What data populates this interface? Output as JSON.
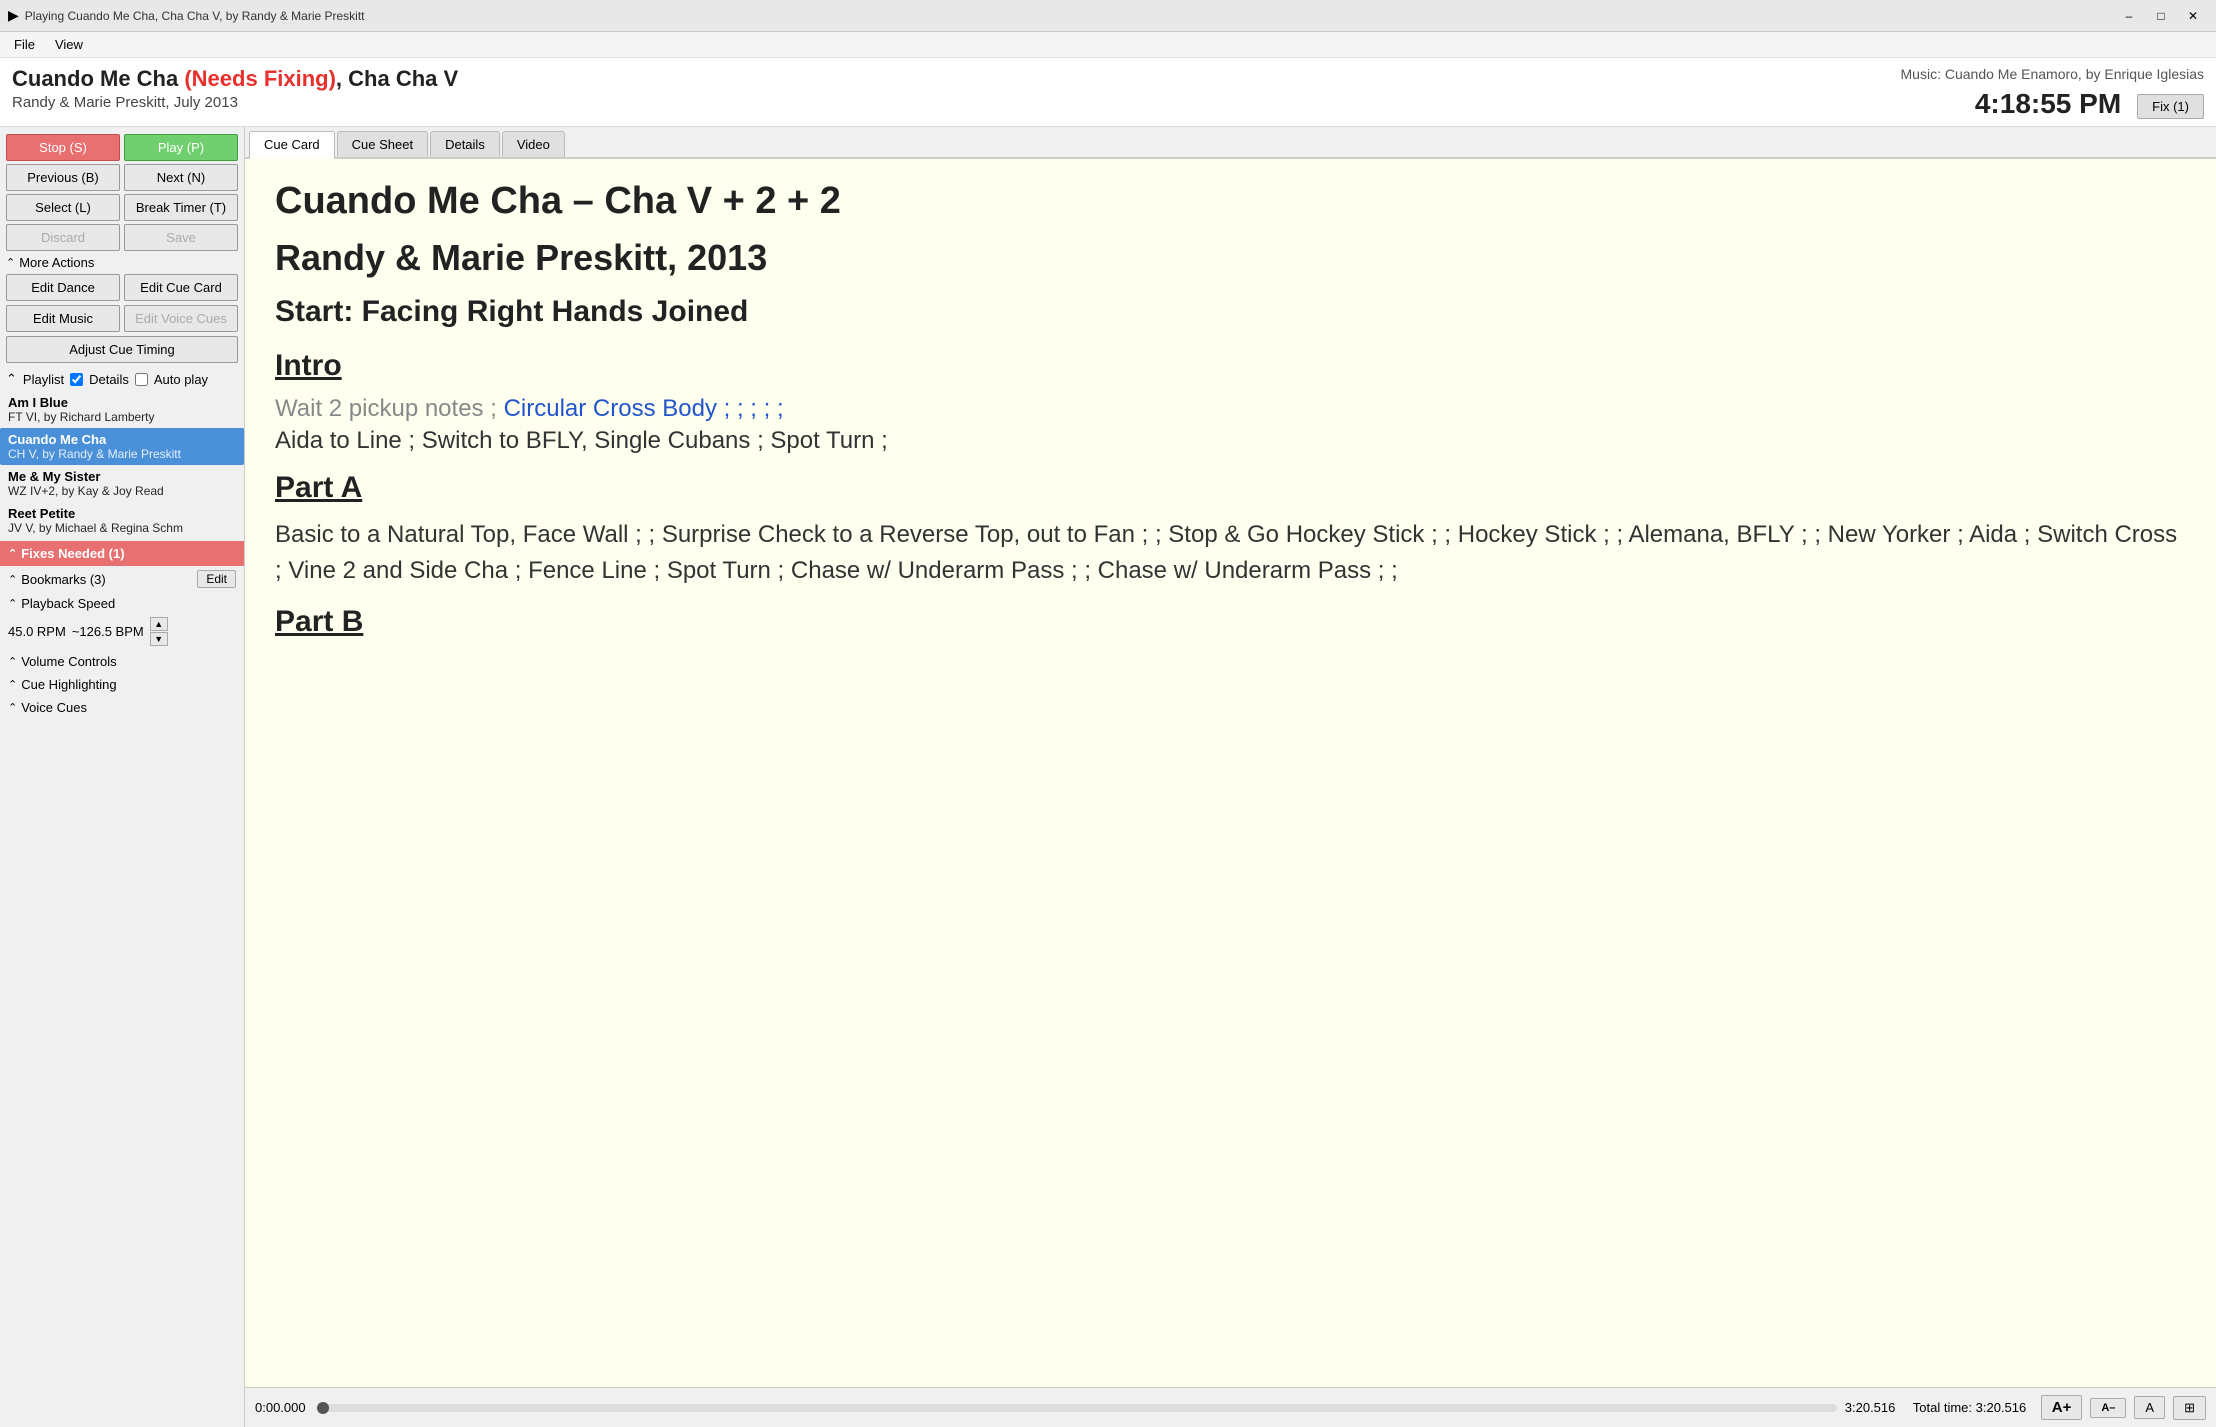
{
  "titlebar": {
    "icon": "▶",
    "title": "Playing Cuando Me Cha, Cha Cha V, by Randy & Marie Preskitt",
    "minimize": "–",
    "maximize": "□",
    "close": "✕"
  },
  "menubar": {
    "items": [
      "File",
      "View"
    ]
  },
  "header": {
    "title_main": "Cuando Me Cha ",
    "title_status": "(Needs Fixing)",
    "title_tail": ", Cha Cha V",
    "subtitle": "Randy & Marie Preskitt, July 2013",
    "music_info": "Music: Cuando Me Enamoro, by Enrique Iglesias",
    "clock": "4:18:55 PM",
    "fix_btn": "Fix (1)"
  },
  "controls": {
    "stop_btn": "Stop (S)",
    "play_btn": "Play (P)",
    "prev_btn": "Previous (B)",
    "next_btn": "Next (N)",
    "select_btn": "Select (L)",
    "break_timer_btn": "Break Timer (T)",
    "discard_btn": "Discard",
    "save_btn": "Save",
    "more_actions_label": "More Actions",
    "edit_dance_btn": "Edit Dance",
    "edit_cue_card_btn": "Edit Cue Card",
    "edit_music_btn": "Edit Music",
    "edit_voice_cues_btn": "Edit Voice Cues",
    "adjust_cue_timing_btn": "Adjust Cue Timing"
  },
  "playlist_section": {
    "label": "Playlist",
    "details_label": "Details",
    "details_checked": true,
    "autoplay_label": "Auto play",
    "autoplay_checked": false,
    "items": [
      {
        "title": "Am I Blue",
        "sub": "FT VI, by Richard Lamberty",
        "active": false
      },
      {
        "title": "Cuando Me Cha",
        "sub": "CH V, by Randy & Marie Preskitt",
        "active": true
      },
      {
        "title": "Me & My Sister",
        "sub": "WZ IV+2, by Kay & Joy Read",
        "active": false
      },
      {
        "title": "Reet Petite",
        "sub": "JV V, by Michael & Regina Schm",
        "active": false
      }
    ]
  },
  "fixes_needed": {
    "label": "Fixes Needed (1)"
  },
  "bookmarks": {
    "label": "Bookmarks (3)",
    "edit_btn": "Edit"
  },
  "playback_speed": {
    "label": "Playback Speed",
    "rpm": "45.0 RPM",
    "bpm": "~126.5 BPM"
  },
  "volume_controls": {
    "label": "Volume Controls"
  },
  "cue_highlighting": {
    "label": "Cue Highlighting"
  },
  "voice_cues": {
    "label": "Voice Cues"
  },
  "tabs": {
    "items": [
      "Cue Card",
      "Cue Sheet",
      "Details",
      "Video"
    ],
    "active": 0
  },
  "cue_card": {
    "title_line1": "Cuando Me Cha – Cha V + 2 + 2",
    "title_line2": "Randy & Marie Preskitt, 2013",
    "start_position": "Start: Facing Right Hands Joined",
    "intro_heading": "Intro",
    "intro_grey": "Wait 2 pickup notes ;",
    "intro_blue": "Circular Cross Body ; ; ; ; ;",
    "intro_continue": "Aida to Line ; Switch to BFLY, Single Cubans ; Spot Turn ;",
    "part_a_heading": "Part A",
    "part_a_text": "Basic to a Natural Top, Face Wall ; ; Surprise Check to a Reverse Top, out to Fan ; ; Stop & Go Hockey Stick ; ; Hockey Stick ; ; Alemana, BFLY ; ; New Yorker ; Aida ; Switch Cross ; Vine 2 and Side Cha ; Fence Line ; Spot Turn ; Chase w/ Underarm Pass ; ; Chase w/ Underarm Pass ; ;",
    "part_b_heading": "Part B"
  },
  "bottom_bar": {
    "time_start": "0:00.000",
    "time_end": "3:20.516",
    "total_time": "Total time: 3:20.516",
    "font_increase_label": "A+",
    "font_decrease_label": "A–",
    "font_normal_label": "A",
    "layout_btn_label": "⊞"
  }
}
